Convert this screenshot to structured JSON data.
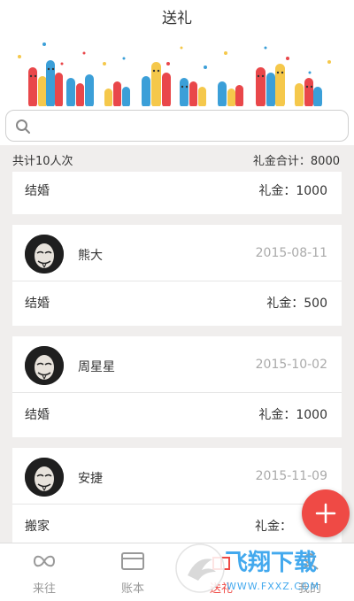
{
  "header": {
    "title": "送礼"
  },
  "search": {
    "placeholder": ""
  },
  "summary": {
    "count_label": "共计10人次",
    "total_label": "礼金合计：8000"
  },
  "records": [
    {
      "name": "",
      "date": "",
      "event": "结婚",
      "gift": "礼金：1000"
    },
    {
      "name": "熊大",
      "date": "2015-08-11",
      "event": "结婚",
      "gift": "礼金：500"
    },
    {
      "name": "周星星",
      "date": "2015-10-02",
      "event": "结婚",
      "gift": "礼金：1000"
    },
    {
      "name": "安捷",
      "date": "2015-11-09",
      "event": "搬家",
      "gift": "礼金："
    }
  ],
  "tabs": [
    {
      "label": "来往",
      "icon": "infinity-icon"
    },
    {
      "label": "账本",
      "icon": "wallet-icon"
    },
    {
      "label": "送礼",
      "icon": "gift-icon",
      "active": true
    },
    {
      "label": "我的",
      "icon": "user-icon"
    }
  ],
  "watermark": {
    "text": "飞翔下载",
    "url": "WWW.FXXZ.COM"
  },
  "colors": {
    "accent": "#ef4a45",
    "background": "#f0eeed",
    "bar_red": "#e9474a",
    "bar_yellow": "#f5c84b",
    "bar_blue": "#3b9fd8"
  }
}
